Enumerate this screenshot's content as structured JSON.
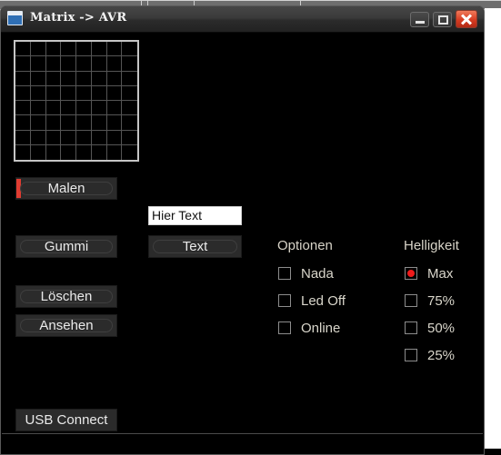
{
  "window": {
    "title": "Matrix -> AVR",
    "icon": "window-app-icon",
    "controls": {
      "minimize": "minimize-icon",
      "maximize": "maximize-icon",
      "close": "close-icon"
    }
  },
  "matrix": {
    "name": "led-matrix-canvas",
    "columns": 8,
    "rows": 8,
    "lit_cells": []
  },
  "tools": {
    "malen_label": "Malen",
    "gummi_label": "Gummi",
    "loeschen_label": "Löschen",
    "ansehen_label": "Ansehen",
    "usb_label": "USB Connect",
    "active_tool": "Malen",
    "accent_color": "#e03c31"
  },
  "text_entry": {
    "value": "Hier Text",
    "placeholder": "Hier Text",
    "button_label": "Text"
  },
  "optionen": {
    "title": "Optionen",
    "items": [
      {
        "label": "Nada",
        "checked": false
      },
      {
        "label": "Led Off",
        "checked": false
      },
      {
        "label": "Online",
        "checked": false
      }
    ]
  },
  "helligkeit": {
    "title": "Helligkeit",
    "items": [
      {
        "label": "Max",
        "checked": true
      },
      {
        "label": "75%",
        "checked": false
      },
      {
        "label": "50%",
        "checked": false
      },
      {
        "label": "25%",
        "checked": false
      }
    ]
  },
  "colors": {
    "window_background": "#000000",
    "titlebar": "#333333",
    "button_face": "#2b2b2b",
    "text": "#eaeaea",
    "selected_red": "#f01b1b",
    "close_button": "#d63c22"
  }
}
